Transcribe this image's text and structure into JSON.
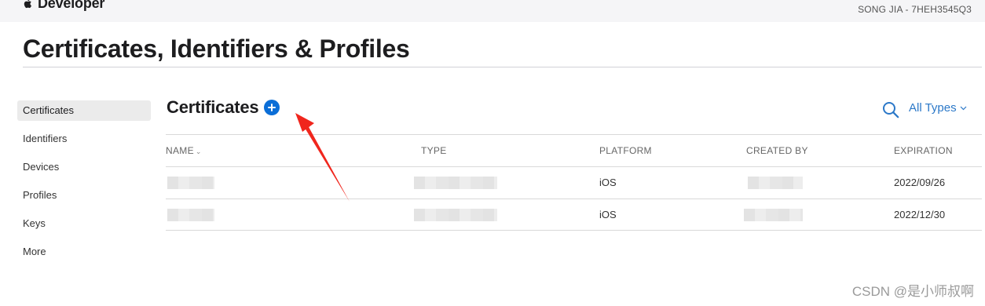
{
  "header": {
    "brand": "Developer",
    "account": "SONG JIA - 7HEH3545Q3"
  },
  "page": {
    "title": "Certificates, Identifiers & Profiles"
  },
  "sidebar": {
    "items": [
      {
        "label": "Certificates",
        "active": true
      },
      {
        "label": "Identifiers"
      },
      {
        "label": "Devices"
      },
      {
        "label": "Profiles"
      },
      {
        "label": "Keys"
      },
      {
        "label": "More"
      }
    ]
  },
  "section": {
    "title": "Certificates",
    "filter_label": "All Types"
  },
  "table": {
    "columns": [
      "NAME",
      "TYPE",
      "PLATFORM",
      "CREATED BY",
      "EXPIRATION"
    ],
    "rows": [
      {
        "name": "",
        "type": "",
        "platform": "iOS",
        "created_by": "",
        "expiration": "2022/09/26"
      },
      {
        "name": "",
        "type": "",
        "platform": "iOS",
        "created_by": "",
        "expiration": "2022/12/30"
      }
    ]
  },
  "annotation": {
    "arrow_color": "#f0261d"
  },
  "watermark": "CSDN @是小师叔啊",
  "colors": {
    "accent": "#0b6ed7",
    "link": "#2b78c8"
  }
}
